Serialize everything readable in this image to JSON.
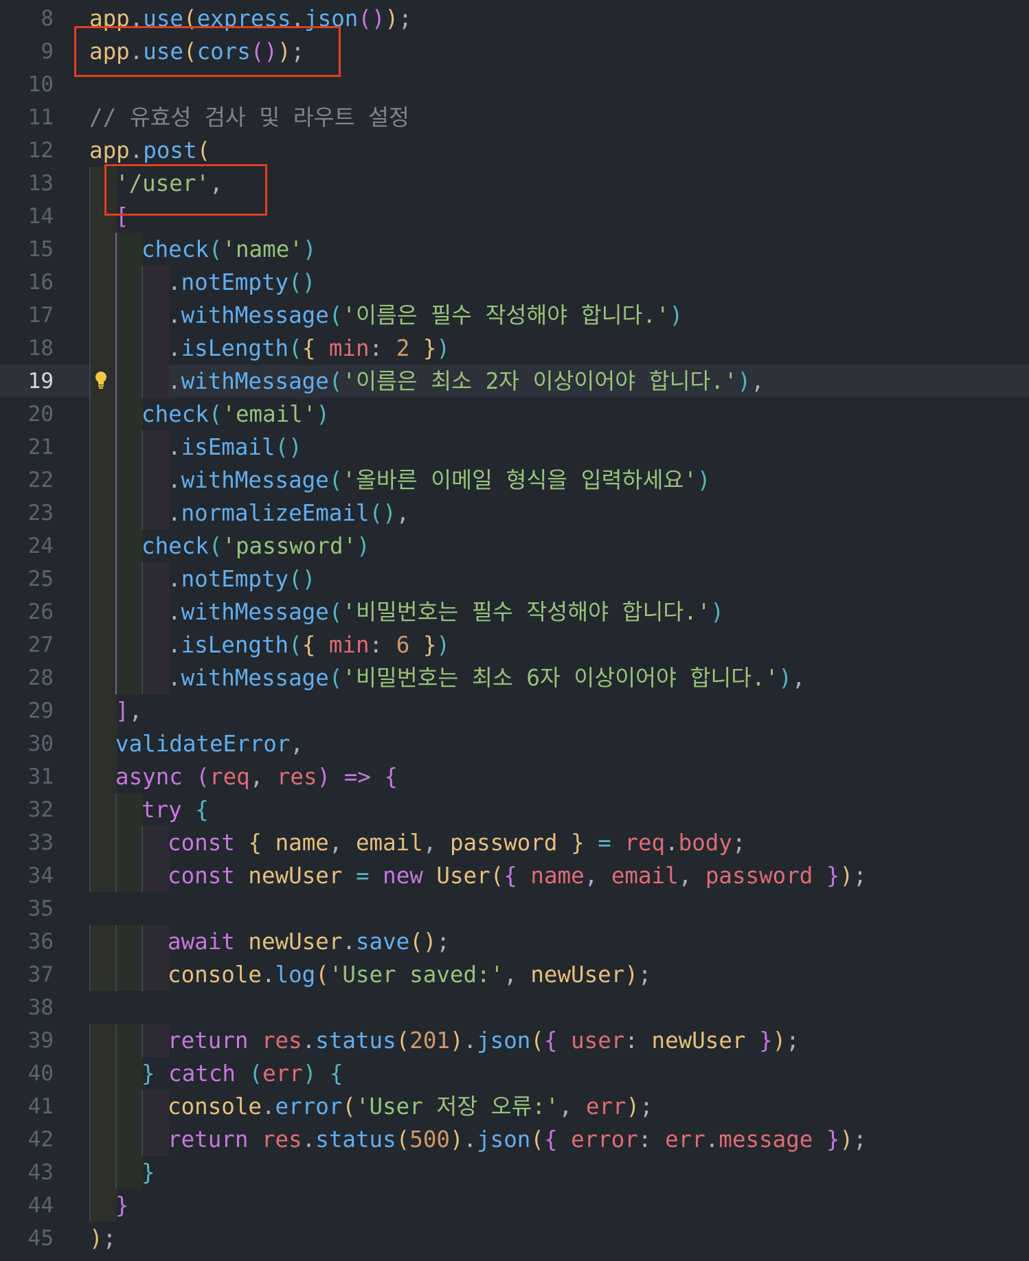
{
  "editor": {
    "current_line": 19,
    "lines": [
      {
        "number": "8",
        "indent": 0,
        "tokens": [
          [
            "app",
            "c-var"
          ],
          [
            ".",
            "c-plain"
          ],
          [
            "use",
            "c-fn"
          ],
          [
            "(",
            "c-p1"
          ],
          [
            "express",
            "c-fn"
          ],
          [
            ".",
            "c-plain"
          ],
          [
            "json",
            "c-fn"
          ],
          [
            "(",
            "c-p2"
          ],
          [
            ")",
            "c-p2"
          ],
          [
            ")",
            "c-p1"
          ],
          [
            ";",
            "c-plain"
          ]
        ]
      },
      {
        "number": "9",
        "indent": 0,
        "tokens": [
          [
            "app",
            "c-var"
          ],
          [
            ".",
            "c-plain"
          ],
          [
            "use",
            "c-fn"
          ],
          [
            "(",
            "c-p1"
          ],
          [
            "cors",
            "c-fn"
          ],
          [
            "(",
            "c-p2"
          ],
          [
            ")",
            "c-p2"
          ],
          [
            ")",
            "c-p1"
          ],
          [
            ";",
            "c-plain"
          ]
        ]
      },
      {
        "number": "10",
        "indent": 0,
        "tokens": []
      },
      {
        "number": "11",
        "indent": 0,
        "tokens": [
          [
            "// 유효성 검사 및 라우트 설정",
            "c-comment"
          ]
        ]
      },
      {
        "number": "12",
        "indent": 0,
        "tokens": [
          [
            "app",
            "c-var"
          ],
          [
            ".",
            "c-plain"
          ],
          [
            "post",
            "c-fn"
          ],
          [
            "(",
            "c-p1"
          ]
        ]
      },
      {
        "number": "13",
        "indent": 1,
        "tokens": [
          [
            "'/user'",
            "c-str"
          ],
          [
            ",",
            "c-plain"
          ]
        ]
      },
      {
        "number": "14",
        "indent": 1,
        "tokens": [
          [
            "[",
            "c-p2"
          ]
        ]
      },
      {
        "number": "15",
        "indent": 2,
        "tokens": [
          [
            "check",
            "c-fn"
          ],
          [
            "(",
            "c-p3"
          ],
          [
            "'name'",
            "c-str"
          ],
          [
            ")",
            "c-p3"
          ]
        ]
      },
      {
        "number": "16",
        "indent": 3,
        "tokens": [
          [
            ".",
            "c-plain"
          ],
          [
            "notEmpty",
            "c-fn"
          ],
          [
            "(",
            "c-p3"
          ],
          [
            ")",
            "c-p3"
          ]
        ]
      },
      {
        "number": "17",
        "indent": 3,
        "tokens": [
          [
            ".",
            "c-plain"
          ],
          [
            "withMessage",
            "c-fn"
          ],
          [
            "(",
            "c-p3"
          ],
          [
            "'이름은 필수 작성해야 합니다.'",
            "c-str"
          ],
          [
            ")",
            "c-p3"
          ]
        ]
      },
      {
        "number": "18",
        "indent": 3,
        "tokens": [
          [
            ".",
            "c-plain"
          ],
          [
            "isLength",
            "c-fn"
          ],
          [
            "(",
            "c-p3"
          ],
          [
            "{ ",
            "c-p1"
          ],
          [
            "min",
            "c-param"
          ],
          [
            ": ",
            "c-plain"
          ],
          [
            "2",
            "c-num"
          ],
          [
            " }",
            "c-p1"
          ],
          [
            ")",
            "c-p3"
          ]
        ]
      },
      {
        "number": "19",
        "indent": 3,
        "tokens": [
          [
            ".",
            "c-plain"
          ],
          [
            "withMessage",
            "c-fn"
          ],
          [
            "(",
            "c-p3"
          ],
          [
            "'이름은 최소 2자 이상이어야 합니다.'",
            "c-str"
          ],
          [
            ")",
            "c-p3"
          ],
          [
            ",",
            "c-plain"
          ]
        ]
      },
      {
        "number": "20",
        "indent": 2,
        "tokens": [
          [
            "check",
            "c-fn"
          ],
          [
            "(",
            "c-p3"
          ],
          [
            "'email'",
            "c-str"
          ],
          [
            ")",
            "c-p3"
          ]
        ]
      },
      {
        "number": "21",
        "indent": 3,
        "tokens": [
          [
            ".",
            "c-plain"
          ],
          [
            "isEmail",
            "c-fn"
          ],
          [
            "(",
            "c-p3"
          ],
          [
            ")",
            "c-p3"
          ]
        ]
      },
      {
        "number": "22",
        "indent": 3,
        "tokens": [
          [
            ".",
            "c-plain"
          ],
          [
            "withMessage",
            "c-fn"
          ],
          [
            "(",
            "c-p3"
          ],
          [
            "'올바른 이메일 형식을 입력하세요'",
            "c-str"
          ],
          [
            ")",
            "c-p3"
          ]
        ]
      },
      {
        "number": "23",
        "indent": 3,
        "tokens": [
          [
            ".",
            "c-plain"
          ],
          [
            "normalizeEmail",
            "c-fn"
          ],
          [
            "(",
            "c-p3"
          ],
          [
            ")",
            "c-p3"
          ],
          [
            ",",
            "c-plain"
          ]
        ]
      },
      {
        "number": "24",
        "indent": 2,
        "tokens": [
          [
            "check",
            "c-fn"
          ],
          [
            "(",
            "c-p3"
          ],
          [
            "'password'",
            "c-str"
          ],
          [
            ")",
            "c-p3"
          ]
        ]
      },
      {
        "number": "25",
        "indent": 3,
        "tokens": [
          [
            ".",
            "c-plain"
          ],
          [
            "notEmpty",
            "c-fn"
          ],
          [
            "(",
            "c-p3"
          ],
          [
            ")",
            "c-p3"
          ]
        ]
      },
      {
        "number": "26",
        "indent": 3,
        "tokens": [
          [
            ".",
            "c-plain"
          ],
          [
            "withMessage",
            "c-fn"
          ],
          [
            "(",
            "c-p3"
          ],
          [
            "'비밀번호는 필수 작성해야 합니다.'",
            "c-str"
          ],
          [
            ")",
            "c-p3"
          ]
        ]
      },
      {
        "number": "27",
        "indent": 3,
        "tokens": [
          [
            ".",
            "c-plain"
          ],
          [
            "isLength",
            "c-fn"
          ],
          [
            "(",
            "c-p3"
          ],
          [
            "{ ",
            "c-p1"
          ],
          [
            "min",
            "c-param"
          ],
          [
            ": ",
            "c-plain"
          ],
          [
            "6",
            "c-num"
          ],
          [
            " }",
            "c-p1"
          ],
          [
            ")",
            "c-p3"
          ]
        ]
      },
      {
        "number": "28",
        "indent": 3,
        "tokens": [
          [
            ".",
            "c-plain"
          ],
          [
            "withMessage",
            "c-fn"
          ],
          [
            "(",
            "c-p3"
          ],
          [
            "'비밀번호는 최소 6자 이상이어야 합니다.'",
            "c-str"
          ],
          [
            ")",
            "c-p3"
          ],
          [
            ",",
            "c-plain"
          ]
        ]
      },
      {
        "number": "29",
        "indent": 1,
        "tokens": [
          [
            "]",
            "c-p2"
          ],
          [
            ",",
            "c-plain"
          ]
        ]
      },
      {
        "number": "30",
        "indent": 1,
        "tokens": [
          [
            "validateError",
            "c-fn"
          ],
          [
            ",",
            "c-plain"
          ]
        ]
      },
      {
        "number": "31",
        "indent": 1,
        "tokens": [
          [
            "async",
            "c-kw"
          ],
          [
            " ",
            "c-plain"
          ],
          [
            "(",
            "c-p2"
          ],
          [
            "req",
            "c-param"
          ],
          [
            ", ",
            "c-plain"
          ],
          [
            "res",
            "c-param"
          ],
          [
            ")",
            "c-p2"
          ],
          [
            " ",
            "c-plain"
          ],
          [
            "=>",
            "c-kw"
          ],
          [
            " ",
            "c-plain"
          ],
          [
            "{",
            "c-p2"
          ]
        ]
      },
      {
        "number": "32",
        "indent": 2,
        "tokens": [
          [
            "try",
            "c-kw"
          ],
          [
            " ",
            "c-plain"
          ],
          [
            "{",
            "c-p3"
          ]
        ]
      },
      {
        "number": "33",
        "indent": 3,
        "tokens": [
          [
            "const",
            "c-kw"
          ],
          [
            " ",
            "c-plain"
          ],
          [
            "{ ",
            "c-p1"
          ],
          [
            "name",
            "c-var"
          ],
          [
            ", ",
            "c-plain"
          ],
          [
            "email",
            "c-var"
          ],
          [
            ", ",
            "c-plain"
          ],
          [
            "password",
            "c-var"
          ],
          [
            " }",
            "c-p1"
          ],
          [
            " ",
            "c-plain"
          ],
          [
            "=",
            "c-op"
          ],
          [
            " ",
            "c-plain"
          ],
          [
            "req",
            "c-param"
          ],
          [
            ".",
            "c-plain"
          ],
          [
            "body",
            "c-param"
          ],
          [
            ";",
            "c-plain"
          ]
        ]
      },
      {
        "number": "34",
        "indent": 3,
        "tokens": [
          [
            "const",
            "c-kw"
          ],
          [
            " ",
            "c-plain"
          ],
          [
            "newUser",
            "c-var"
          ],
          [
            " ",
            "c-plain"
          ],
          [
            "=",
            "c-op"
          ],
          [
            " ",
            "c-plain"
          ],
          [
            "new",
            "c-kw"
          ],
          [
            " ",
            "c-plain"
          ],
          [
            "User",
            "c-var"
          ],
          [
            "(",
            "c-p1"
          ],
          [
            "{ ",
            "c-p2"
          ],
          [
            "name",
            "c-param"
          ],
          [
            ", ",
            "c-plain"
          ],
          [
            "email",
            "c-param"
          ],
          [
            ", ",
            "c-plain"
          ],
          [
            "password",
            "c-param"
          ],
          [
            " }",
            "c-p2"
          ],
          [
            ")",
            "c-p1"
          ],
          [
            ";",
            "c-plain"
          ]
        ]
      },
      {
        "number": "35",
        "indent": 0,
        "tokens": []
      },
      {
        "number": "36",
        "indent": 3,
        "tokens": [
          [
            "await",
            "c-kw"
          ],
          [
            " ",
            "c-plain"
          ],
          [
            "newUser",
            "c-var"
          ],
          [
            ".",
            "c-plain"
          ],
          [
            "save",
            "c-fn"
          ],
          [
            "(",
            "c-p1"
          ],
          [
            ")",
            "c-p1"
          ],
          [
            ";",
            "c-plain"
          ]
        ]
      },
      {
        "number": "37",
        "indent": 3,
        "tokens": [
          [
            "console",
            "c-var"
          ],
          [
            ".",
            "c-plain"
          ],
          [
            "log",
            "c-fn"
          ],
          [
            "(",
            "c-p1"
          ],
          [
            "'User saved:'",
            "c-str"
          ],
          [
            ", ",
            "c-plain"
          ],
          [
            "newUser",
            "c-var"
          ],
          [
            ")",
            "c-p1"
          ],
          [
            ";",
            "c-plain"
          ]
        ]
      },
      {
        "number": "38",
        "indent": 0,
        "tokens": []
      },
      {
        "number": "39",
        "indent": 3,
        "tokens": [
          [
            "return",
            "c-kw"
          ],
          [
            " ",
            "c-plain"
          ],
          [
            "res",
            "c-param"
          ],
          [
            ".",
            "c-plain"
          ],
          [
            "status",
            "c-fn"
          ],
          [
            "(",
            "c-p1"
          ],
          [
            "201",
            "c-num"
          ],
          [
            ")",
            "c-p1"
          ],
          [
            ".",
            "c-plain"
          ],
          [
            "json",
            "c-fn"
          ],
          [
            "(",
            "c-p1"
          ],
          [
            "{ ",
            "c-p2"
          ],
          [
            "user",
            "c-param"
          ],
          [
            ": ",
            "c-plain"
          ],
          [
            "newUser",
            "c-var"
          ],
          [
            " }",
            "c-p2"
          ],
          [
            ")",
            "c-p1"
          ],
          [
            ";",
            "c-plain"
          ]
        ]
      },
      {
        "number": "40",
        "indent": 2,
        "tokens": [
          [
            "}",
            "c-p3"
          ],
          [
            " ",
            "c-plain"
          ],
          [
            "catch",
            "c-kw"
          ],
          [
            " ",
            "c-plain"
          ],
          [
            "(",
            "c-p3"
          ],
          [
            "err",
            "c-param"
          ],
          [
            ")",
            "c-p3"
          ],
          [
            " ",
            "c-plain"
          ],
          [
            "{",
            "c-p3"
          ]
        ]
      },
      {
        "number": "41",
        "indent": 3,
        "tokens": [
          [
            "console",
            "c-var"
          ],
          [
            ".",
            "c-plain"
          ],
          [
            "error",
            "c-fn"
          ],
          [
            "(",
            "c-p1"
          ],
          [
            "'User 저장 오류:'",
            "c-str"
          ],
          [
            ", ",
            "c-plain"
          ],
          [
            "err",
            "c-param"
          ],
          [
            ")",
            "c-p1"
          ],
          [
            ";",
            "c-plain"
          ]
        ]
      },
      {
        "number": "42",
        "indent": 3,
        "tokens": [
          [
            "return",
            "c-kw"
          ],
          [
            " ",
            "c-plain"
          ],
          [
            "res",
            "c-param"
          ],
          [
            ".",
            "c-plain"
          ],
          [
            "status",
            "c-fn"
          ],
          [
            "(",
            "c-p1"
          ],
          [
            "500",
            "c-num"
          ],
          [
            ")",
            "c-p1"
          ],
          [
            ".",
            "c-plain"
          ],
          [
            "json",
            "c-fn"
          ],
          [
            "(",
            "c-p1"
          ],
          [
            "{ ",
            "c-p2"
          ],
          [
            "error",
            "c-param"
          ],
          [
            ": ",
            "c-plain"
          ],
          [
            "err",
            "c-param"
          ],
          [
            ".",
            "c-plain"
          ],
          [
            "message",
            "c-param"
          ],
          [
            " }",
            "c-p2"
          ],
          [
            ")",
            "c-p1"
          ],
          [
            ";",
            "c-plain"
          ]
        ]
      },
      {
        "number": "43",
        "indent": 2,
        "tokens": [
          [
            "}",
            "c-p3"
          ]
        ]
      },
      {
        "number": "44",
        "indent": 1,
        "tokens": [
          [
            "}",
            "c-p2"
          ]
        ]
      },
      {
        "number": "45",
        "indent": 0,
        "tokens": [
          [
            ")",
            "c-p1"
          ],
          [
            ";",
            "c-plain"
          ]
        ]
      }
    ]
  },
  "annotations": {
    "box_color": "#e0401f",
    "highlighted_lines": [
      "9",
      "13"
    ]
  },
  "lightbulb": {
    "icon": "lightbulb-icon",
    "line": "19",
    "color": "#f2c744"
  },
  "theme": {
    "background": "#23272e",
    "current_line_background": "#2c313a",
    "line_number_color": "#5c6370"
  }
}
